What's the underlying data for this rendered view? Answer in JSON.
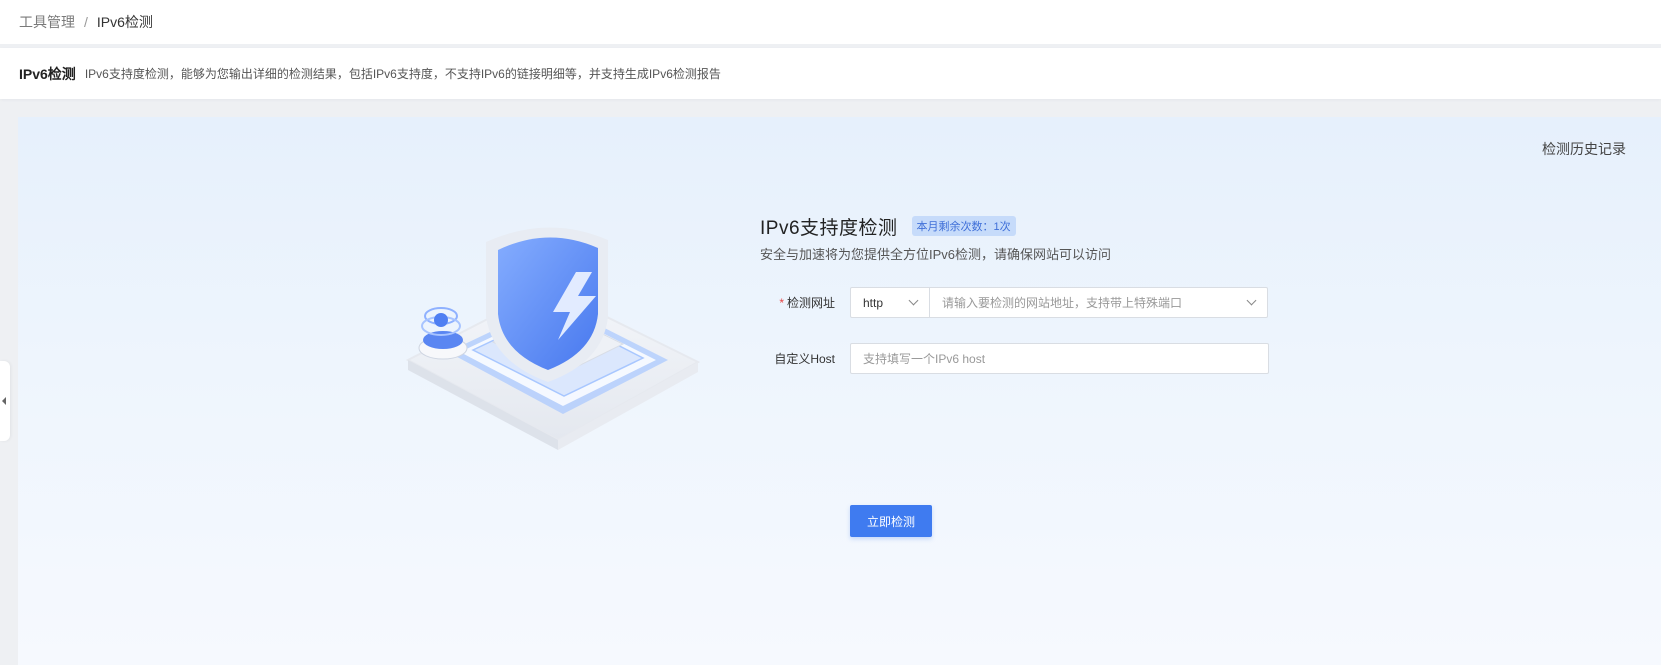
{
  "breadcrumb": {
    "parent": "工具管理",
    "separator": "/",
    "current": "IPv6检测"
  },
  "header": {
    "title": "IPv6检测",
    "description": "IPv6支持度检测，能够为您输出详细的检测结果，包括IPv6支持度，不支持IPv6的链接明细等，并支持生成IPv6检测报告"
  },
  "main": {
    "history_link": "检测历史记录",
    "form_title": "IPv6支持度检测",
    "quota_badge": "本月剩余次数：1次",
    "subtitle": "安全与加速将为您提供全方位IPv6检测，请确保网站可以访问",
    "url_field": {
      "required_mark": "*",
      "label": "检测网址",
      "protocol_value": "http",
      "placeholder": "请输入要检测的网站地址，支持带上特殊端口"
    },
    "host_field": {
      "label": "自定义Host",
      "placeholder": "支持填写一个IPv6 host"
    },
    "submit_label": "立即检测"
  },
  "colors": {
    "primary": "#3f7bf0",
    "badge_bg": "#c6dbfa",
    "required": "#e54545"
  },
  "icons": [
    "shield-lightning-illustration",
    "chevron-down-icon",
    "collapse-arrow-icon"
  ]
}
